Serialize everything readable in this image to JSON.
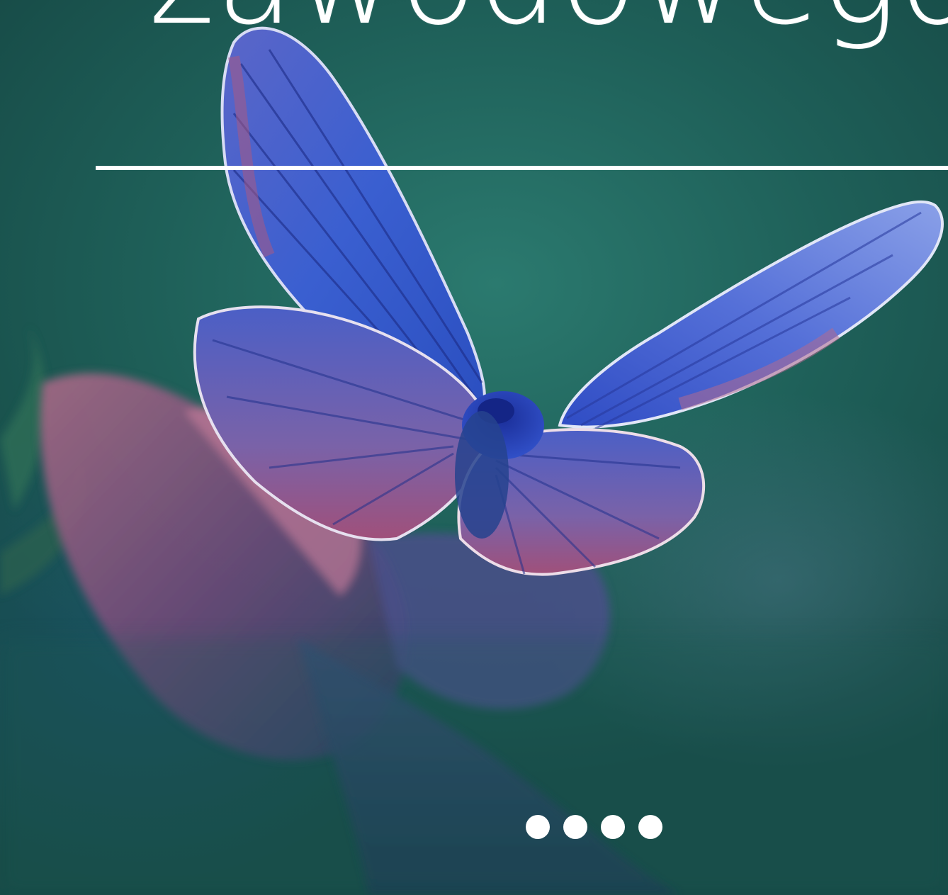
{
  "hero": {
    "title": "zawodowego",
    "background_image": "butterfly-on-flower-photo",
    "colors": {
      "background": "#1f5a55",
      "text": "#ffffff",
      "rule": "#ffffff"
    }
  },
  "carousel": {
    "dot_count": 4,
    "active_index": null
  }
}
